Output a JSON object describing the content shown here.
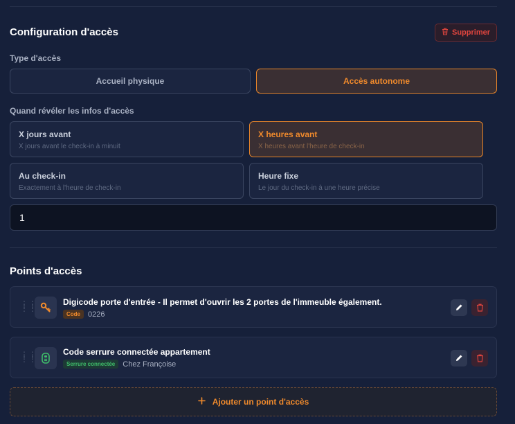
{
  "access_config": {
    "title": "Configuration d'accès",
    "delete_label": "Supprimer",
    "type_label": "Type d'accès",
    "types": [
      {
        "label": "Accueil physique",
        "selected": false
      },
      {
        "label": "Accès autonome",
        "selected": true
      }
    ],
    "reveal_label": "Quand révéler les infos d'accès",
    "reveal_options": [
      {
        "title": "X jours avant",
        "desc": "X jours avant le check-in à minuit",
        "selected": false
      },
      {
        "title": "X heures avant",
        "desc": "X heures avant l'heure de check-in",
        "selected": true
      },
      {
        "title": "Au check-in",
        "desc": "Exactement à l'heure de check-in",
        "selected": false
      },
      {
        "title": "Heure fixe",
        "desc": "Le jour du check-in à une heure précise",
        "selected": false
      }
    ],
    "value_input": "1"
  },
  "access_points": {
    "title": "Points d'accès",
    "items": [
      {
        "name": "Digicode porte d'entrée - Il permet d'ouvrir les 2 portes de l'immeuble également.",
        "badge": "Code",
        "value": "0226",
        "icon": "key-icon"
      },
      {
        "name": "Code serrure connectée appartement",
        "badge": "Serrure connectée",
        "value": "Chez Françoise",
        "icon": "smart-lock-icon"
      }
    ],
    "add_label": "Ajouter un point d'accès"
  },
  "colors": {
    "background": "#16203a",
    "accent": "#f08a2c",
    "danger": "#e0453e",
    "success": "#3fbf6a"
  }
}
